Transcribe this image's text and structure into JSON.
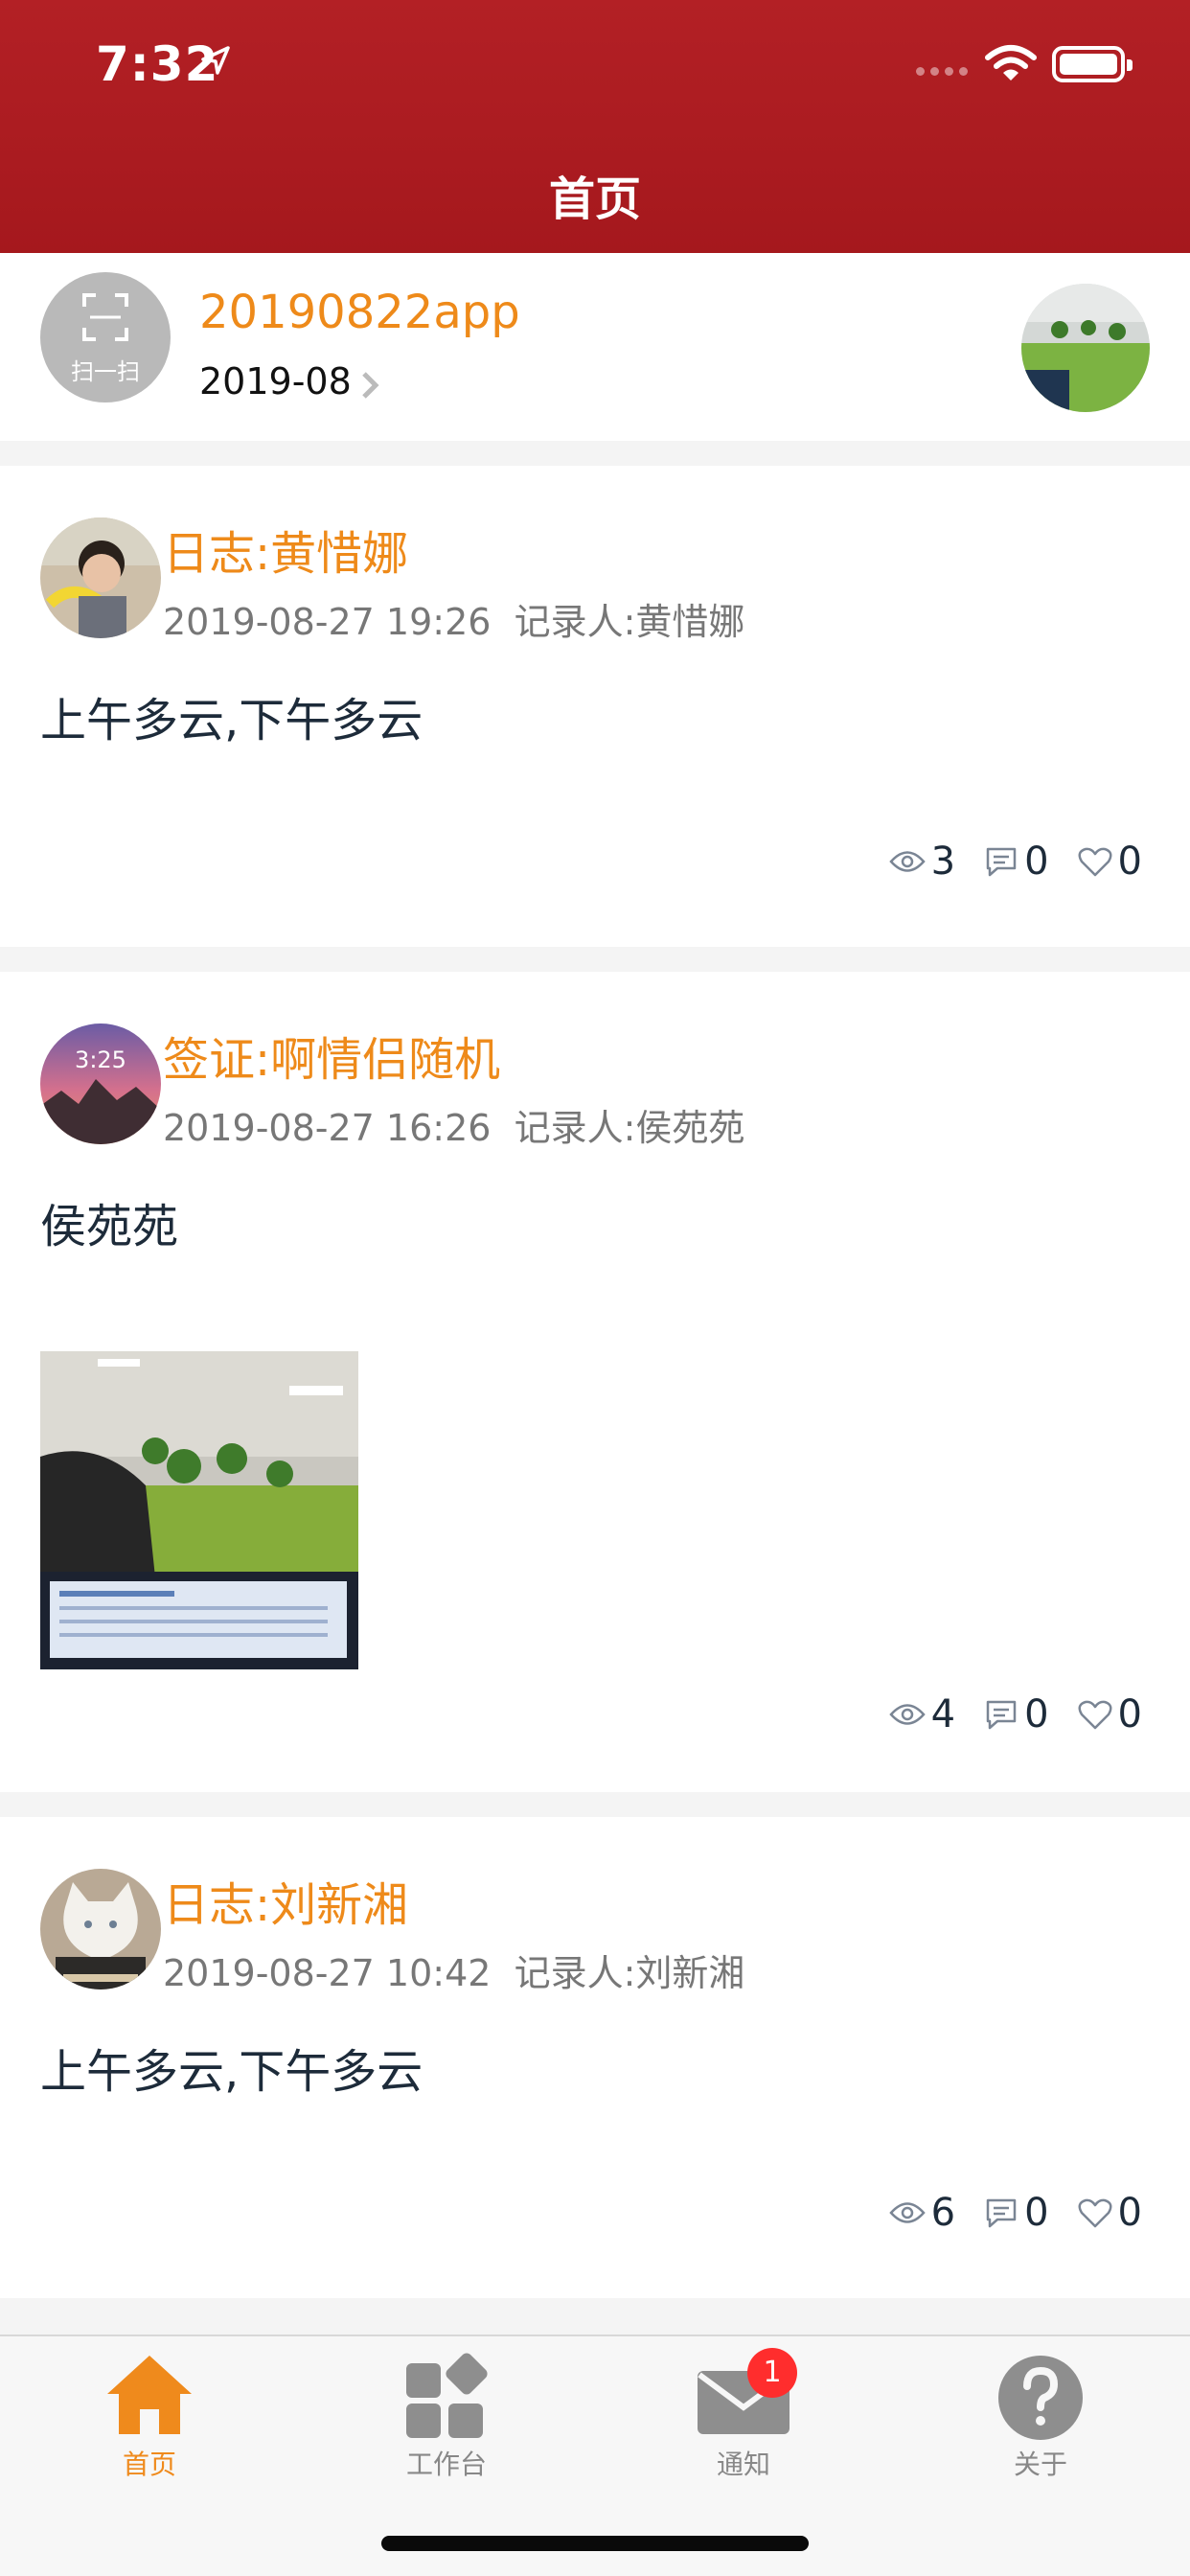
{
  "status_bar": {
    "time": "7:32"
  },
  "header": {
    "title": "首页"
  },
  "profile": {
    "scan_label": "扫一扫",
    "name": "20190822app",
    "date": "2019-08"
  },
  "feed": [
    {
      "title": "日志:黄惜娜",
      "meta": "2019-08-27 19:26  记录人:黄惜娜",
      "body": "上午多云,下午多云",
      "views": "3",
      "comments": "0",
      "likes": "0"
    },
    {
      "title": "签证:啊情侣随机",
      "meta": "2019-08-27 16:26  记录人:侯苑苑",
      "body": "侯苑苑",
      "avatar_text": "3:25",
      "views": "4",
      "comments": "0",
      "likes": "0"
    },
    {
      "title": "日志:刘新湘",
      "meta": "2019-08-27 10:42  记录人:刘新湘",
      "body": "上午多云,下午多云",
      "views": "6",
      "comments": "0",
      "likes": "0"
    }
  ],
  "tabbar": {
    "tabs": [
      {
        "label": "首页",
        "icon": "home-icon"
      },
      {
        "label": "工作台",
        "icon": "workbench-icon"
      },
      {
        "label": "通知",
        "icon": "mail-icon",
        "badge": "1"
      },
      {
        "label": "关于",
        "icon": "question-icon"
      }
    ]
  },
  "colors": {
    "header": "#a5181d",
    "accent": "#ee8a1a",
    "badge": "#ff2d2d"
  }
}
